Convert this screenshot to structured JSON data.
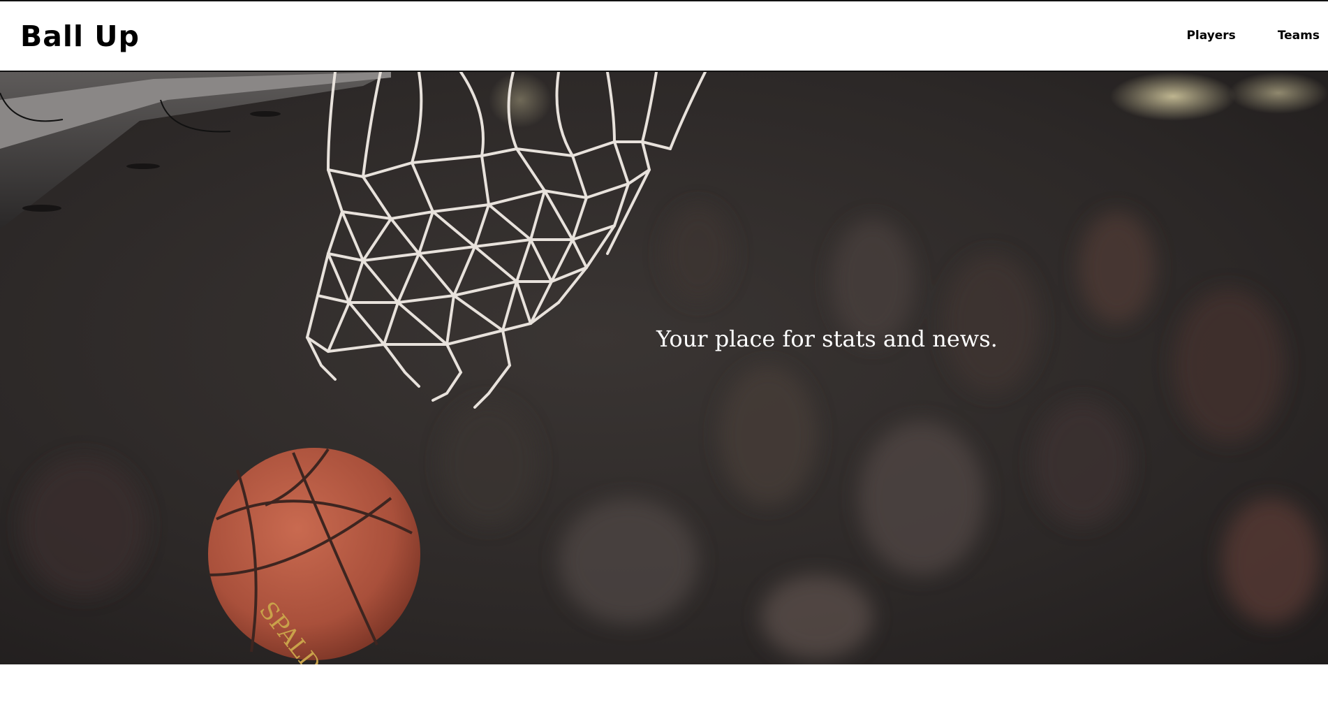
{
  "header": {
    "brand": "Ball Up",
    "nav": [
      {
        "label": "Players"
      },
      {
        "label": "Teams"
      }
    ]
  },
  "hero": {
    "tagline": "Your place for stats and news.",
    "ball_brand": "SPALDING"
  },
  "colors": {
    "header_background": "#ffffff",
    "header_text": "#000000",
    "hero_overlay_text": "#ffffff",
    "ball": "#b85b44",
    "net": "#e8e2dc"
  },
  "icons": {
    "hero_image": "basketball-hoop-photo"
  }
}
